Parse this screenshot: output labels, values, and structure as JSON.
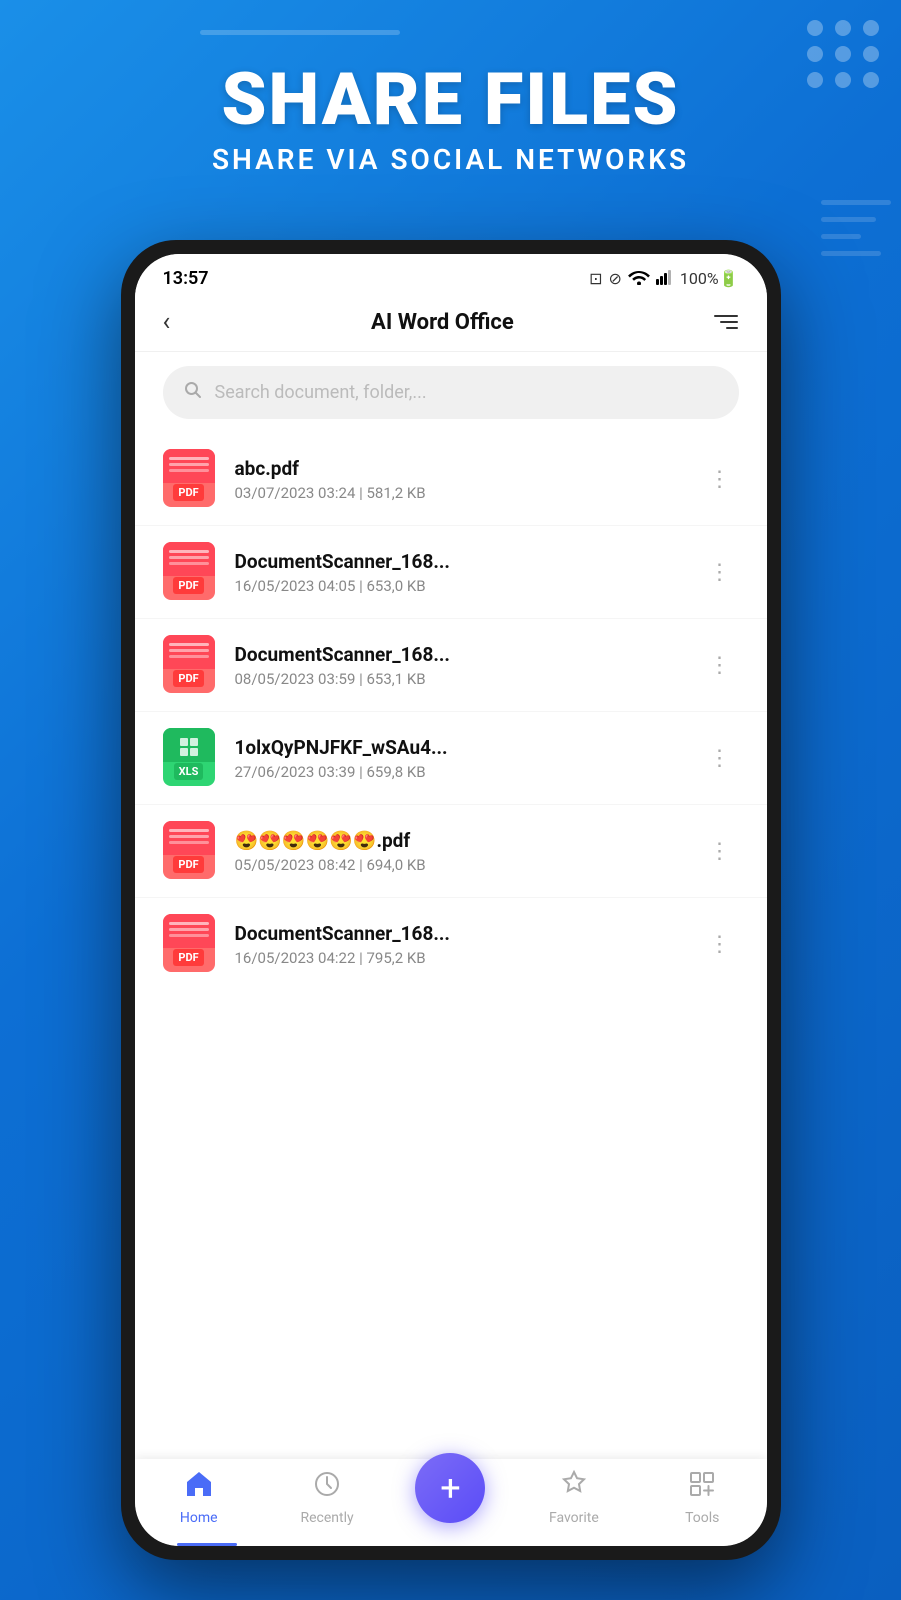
{
  "header": {
    "title": "SHARE FILES",
    "subtitle": "SHARE VIA SOCIAL NETWORKS"
  },
  "phone": {
    "status_bar": {
      "time": "13:57",
      "battery": "100%"
    },
    "nav": {
      "title": "AI Word Office",
      "back_label": "‹",
      "filter_label": "filter"
    },
    "search": {
      "placeholder": "Search document, folder,..."
    },
    "files": [
      {
        "name": "abc.pdf",
        "date": "03/07/2023 03:24",
        "size": "581,2 KB",
        "type": "pdf"
      },
      {
        "name": "DocumentScanner_168...",
        "date": "16/05/2023 04:05",
        "size": "653,0 KB",
        "type": "pdf"
      },
      {
        "name": "DocumentScanner_168...",
        "date": "08/05/2023 03:59",
        "size": "653,1 KB",
        "type": "pdf"
      },
      {
        "name": "1olxQyPNJFKF_wSAu4...",
        "date": "27/06/2023 03:39",
        "size": "659,8 KB",
        "type": "xls"
      },
      {
        "name": "😍😍😍😍😍😍.pdf",
        "date": "05/05/2023 08:42",
        "size": "694,0 KB",
        "type": "pdf"
      },
      {
        "name": "DocumentScanner_168...",
        "date": "16/05/2023 04:22",
        "size": "795,2 KB",
        "type": "pdf"
      }
    ],
    "bottom_nav": {
      "items": [
        {
          "label": "Home",
          "icon": "home",
          "active": true
        },
        {
          "label": "Recently",
          "icon": "clock",
          "active": false
        },
        {
          "label": "",
          "icon": "plus",
          "active": false
        },
        {
          "label": "Favorite",
          "icon": "star",
          "active": false
        },
        {
          "label": "Tools",
          "icon": "tools",
          "active": false
        }
      ]
    }
  }
}
